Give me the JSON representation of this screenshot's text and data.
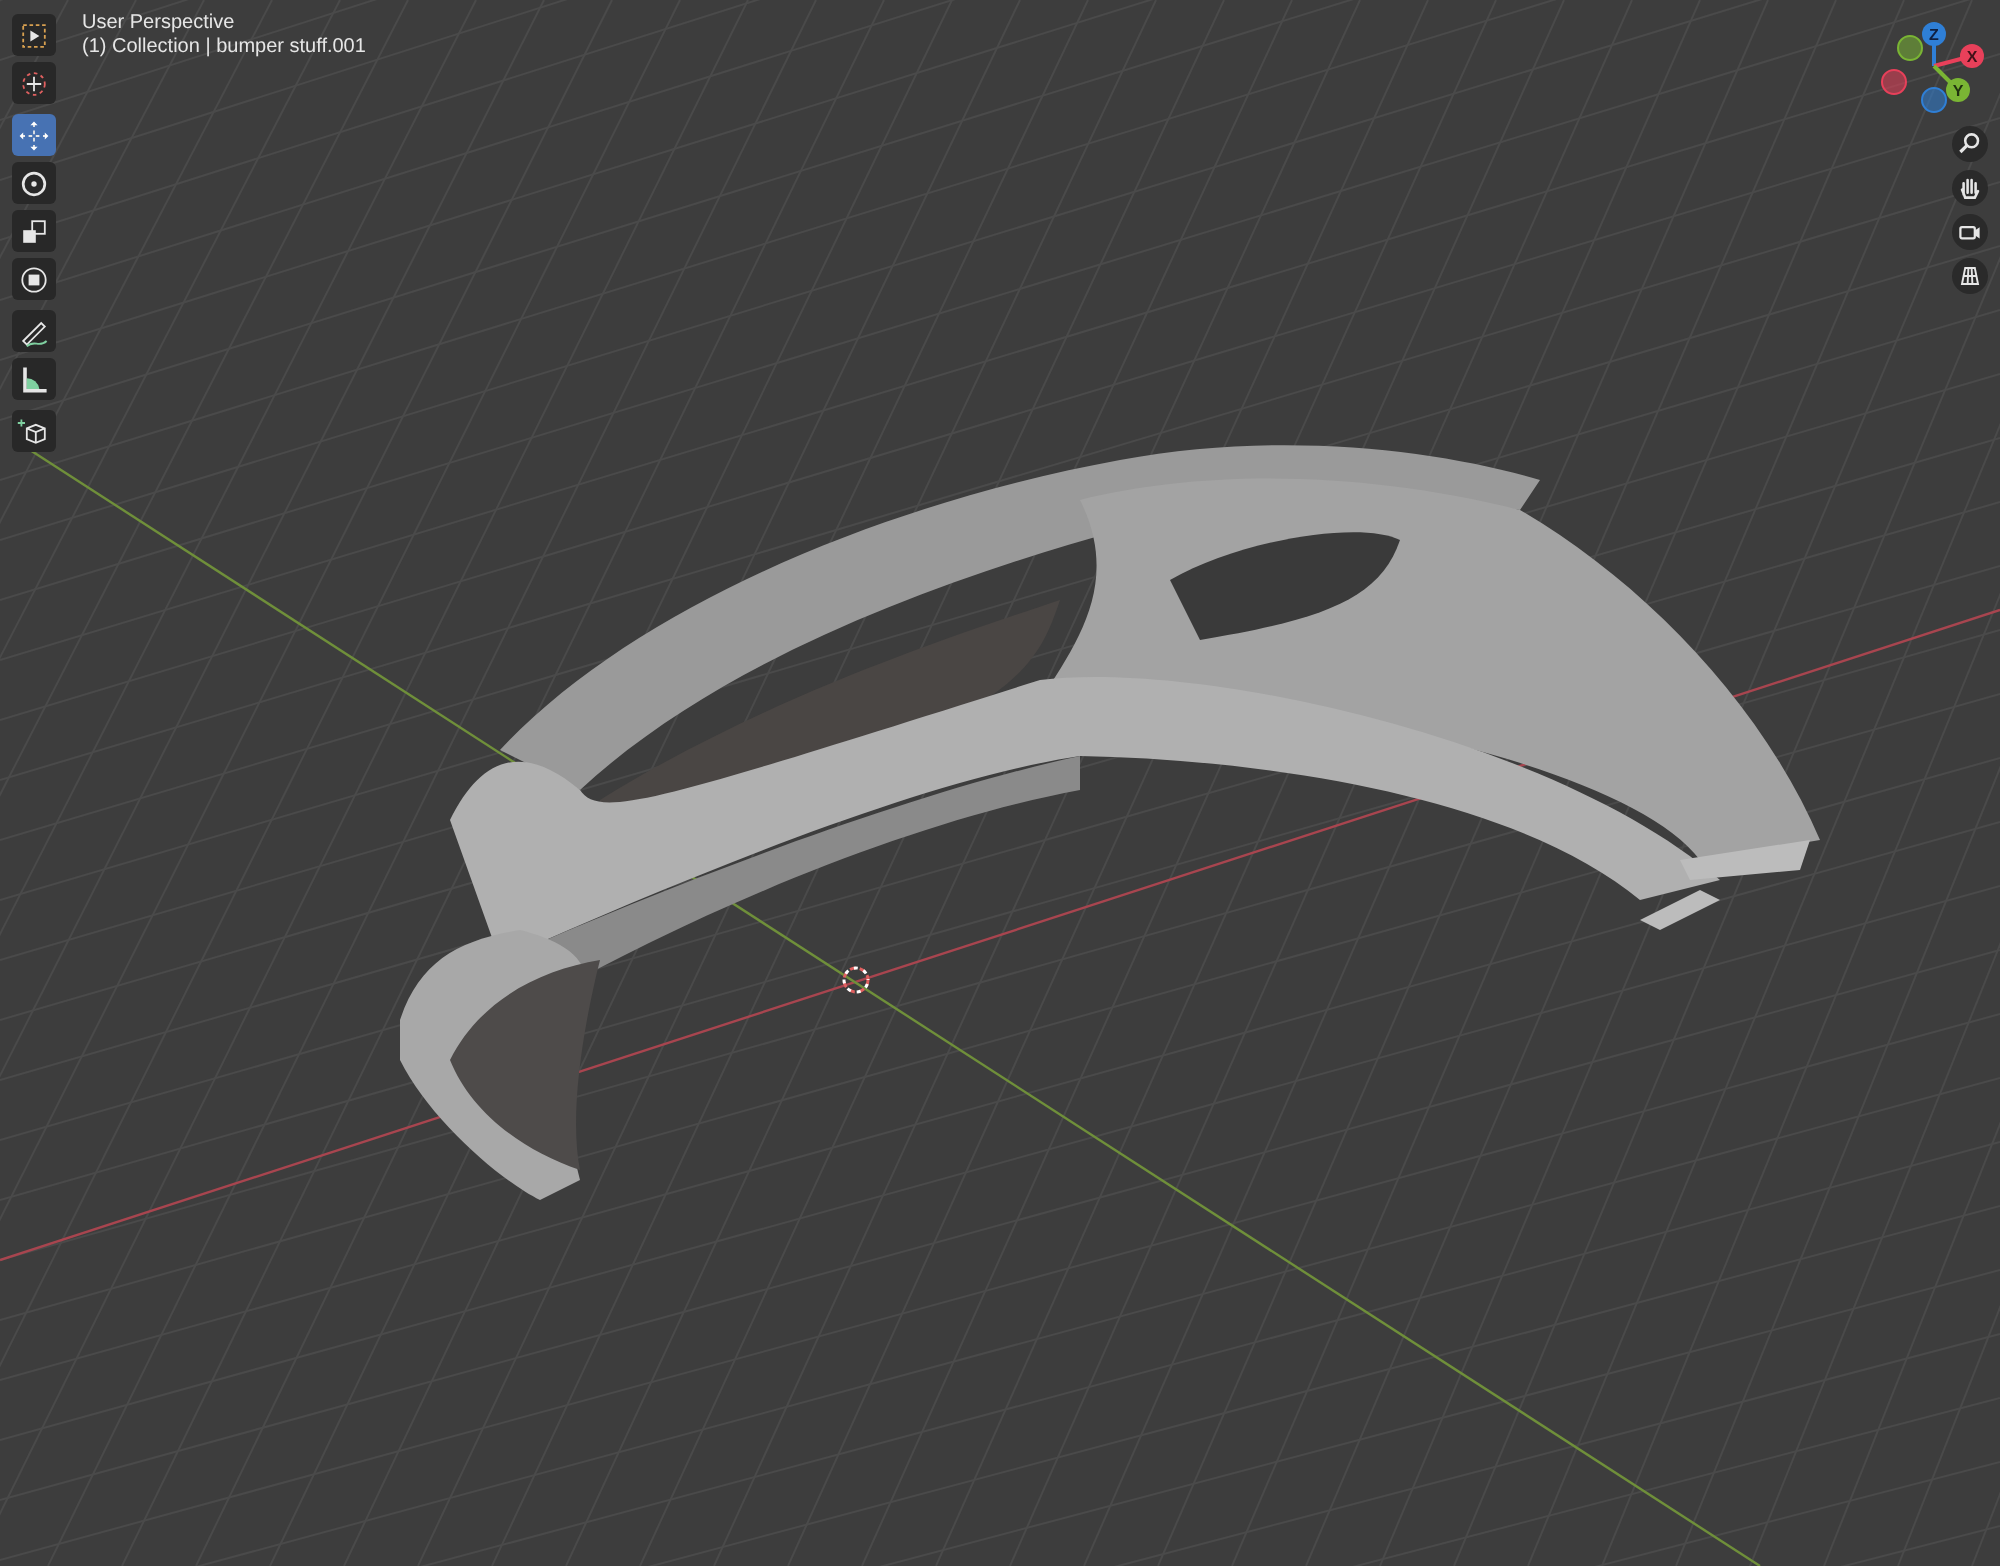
{
  "viewport": {
    "title": "User Perspective",
    "subtitle": "(1) Collection | bumper stuff.001"
  },
  "tool_groups": [
    [
      {
        "kind": "select_box",
        "selected": false
      },
      {
        "kind": "cursor",
        "selected": false
      }
    ],
    [
      {
        "kind": "move",
        "selected": true
      },
      {
        "kind": "rotate",
        "selected": false
      },
      {
        "kind": "scale",
        "selected": false
      },
      {
        "kind": "transform",
        "selected": false
      }
    ],
    [
      {
        "kind": "annotate",
        "selected": false
      },
      {
        "kind": "measure",
        "selected": false
      }
    ],
    [
      {
        "kind": "add_cube",
        "selected": false
      }
    ]
  ],
  "gizmo": {
    "axes": [
      {
        "kind": "z",
        "label": "Z"
      },
      {
        "kind": "x",
        "label": "X"
      },
      {
        "kind": "y",
        "label": "Y"
      }
    ]
  },
  "nav_buttons": [
    {
      "kind": "zoom"
    },
    {
      "kind": "pan"
    },
    {
      "kind": "camera"
    },
    {
      "kind": "ortho"
    }
  ]
}
